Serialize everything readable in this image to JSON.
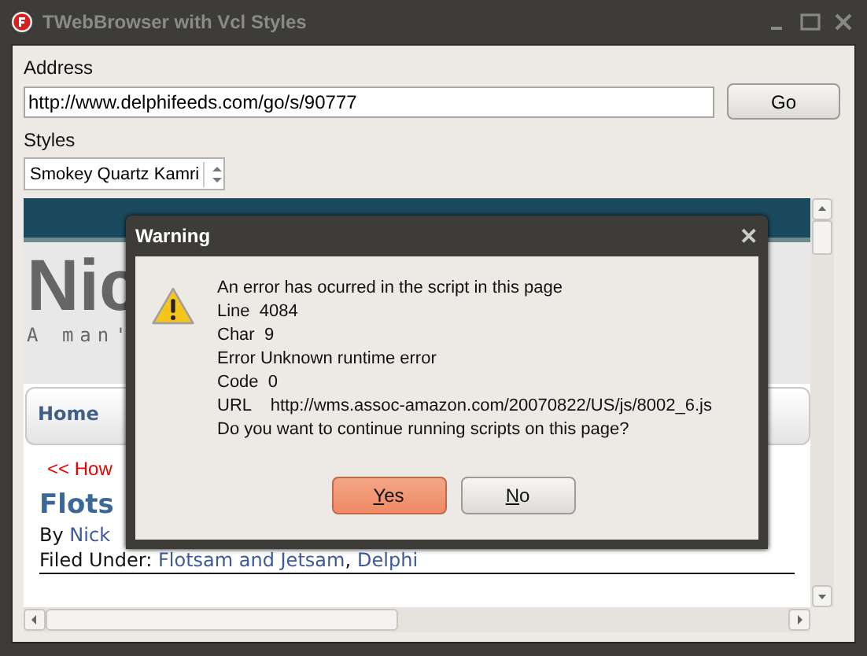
{
  "window": {
    "title": "TWebBrowser with Vcl Styles"
  },
  "address": {
    "label": "Address",
    "value": "http://www.delphifeeds.com/go/s/90777",
    "button": "Go"
  },
  "styles": {
    "label": "Styles",
    "value": "Smokey Quartz Kamri"
  },
  "web_page": {
    "site_title": "Nic",
    "tagline": "A man'",
    "nav": [
      "Home"
    ],
    "prev_link": "<< How",
    "post_title": "Flots",
    "byline": {
      "prefix": "By ",
      "author": "Nick"
    },
    "filed": {
      "prefix": "Filed Under: ",
      "links": [
        "Flotsam and Jetsam",
        "Delphi"
      ],
      "separator": ","
    }
  },
  "dialog": {
    "title": "Warning",
    "close": "✕",
    "lines": [
      "An error has ocurred in the script in this page",
      "Line  4084",
      "Char  9",
      "Error Unknown runtime error",
      "Code  0",
      "URL    http://wms.assoc-amazon.com/20070822/US/js/8002_6.js",
      "Do you want to continue running scripts on this page?"
    ],
    "buttons": [
      {
        "label": "Yes",
        "selected": true
      },
      {
        "label": "No",
        "selected": false
      }
    ]
  }
}
